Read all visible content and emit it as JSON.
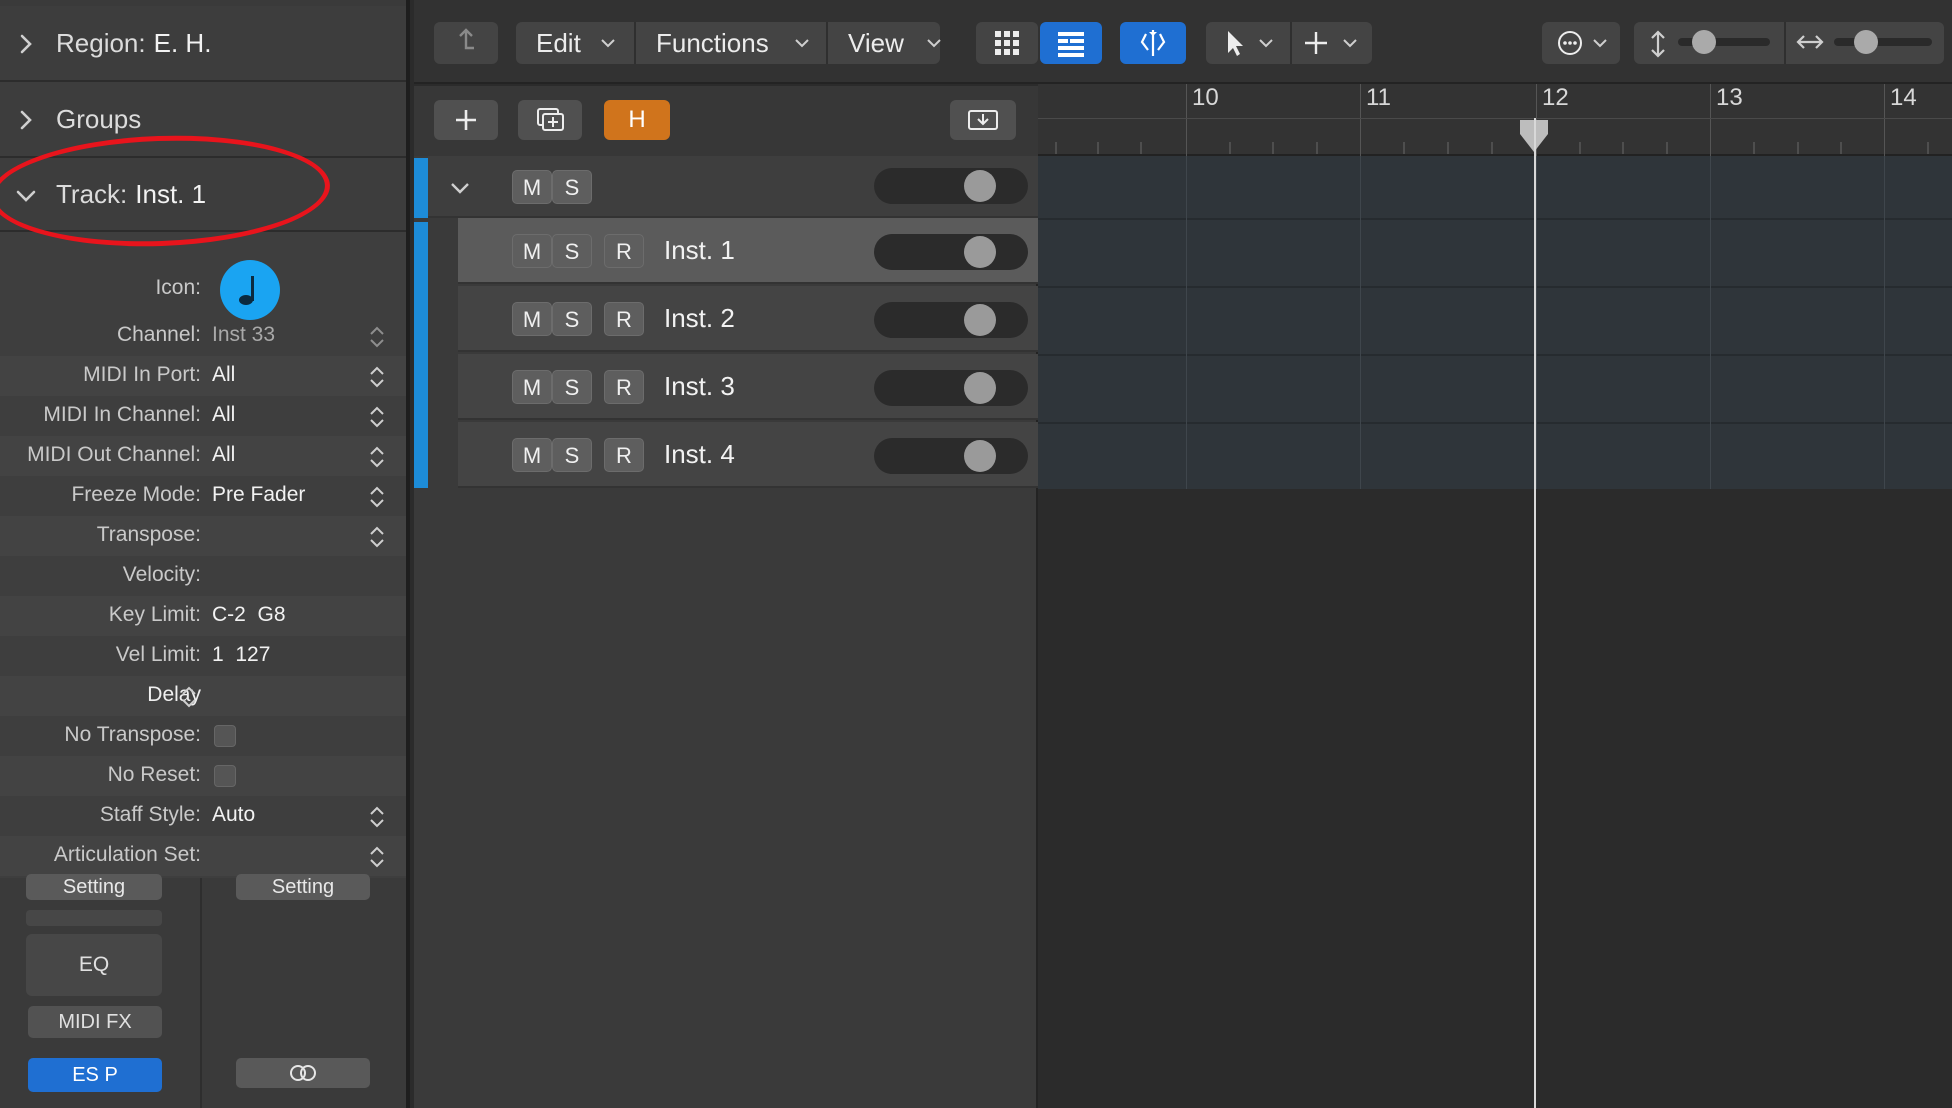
{
  "inspector": {
    "region": {
      "label": "Region:",
      "value": "E. H."
    },
    "groups": {
      "label": "Groups"
    },
    "track": {
      "label": "Track:",
      "value": "Inst. 1"
    },
    "icon_label": "Icon:",
    "icon_color": "#1aa4f2",
    "props": [
      {
        "label": "Channel:",
        "value": "Inst 33"
      },
      {
        "label": "MIDI In Port:",
        "value": "All"
      },
      {
        "label": "MIDI In Channel:",
        "value": "All"
      },
      {
        "label": "MIDI Out Channel:",
        "value": "All"
      },
      {
        "label": "Freeze Mode:",
        "value": "Pre Fader"
      },
      {
        "label": "Transpose:",
        "value": ""
      },
      {
        "label": "Velocity:",
        "value": ""
      },
      {
        "label": "Key Limit:",
        "value": "C-2  G8"
      },
      {
        "label": "Vel Limit:",
        "value": "1  127"
      },
      {
        "label": "Delay",
        "value": ""
      },
      {
        "label": "No Transpose:",
        "value": ""
      },
      {
        "label": "No Reset:",
        "value": ""
      },
      {
        "label": "Staff Style:",
        "value": "Auto"
      },
      {
        "label": "Articulation Set:",
        "value": ""
      }
    ],
    "strip": {
      "setting_left": "Setting",
      "setting_right": "Setting",
      "eq": "EQ",
      "midi_fx": "MIDI FX",
      "instrument": "ES P"
    }
  },
  "toolbar": {
    "edit": "Edit",
    "functions": "Functions",
    "view": "View"
  },
  "track_header": {
    "hide_button": "H",
    "folder_row": {
      "mute": "M",
      "solo": "S"
    },
    "tracks": [
      {
        "mute": "M",
        "solo": "S",
        "record": "R",
        "name": "Inst. 1"
      },
      {
        "mute": "M",
        "solo": "S",
        "record": "R",
        "name": "Inst. 2"
      },
      {
        "mute": "M",
        "solo": "S",
        "record": "R",
        "name": "Inst. 3"
      },
      {
        "mute": "M",
        "solo": "S",
        "record": "R",
        "name": "Inst. 4"
      }
    ]
  },
  "ruler": {
    "bars": [
      "10",
      "11",
      "12",
      "13",
      "14"
    ]
  },
  "colors": {
    "accent_blue": "#1f6fd2",
    "track_color": "#1d8cd8",
    "hide_orange": "#d0741c",
    "annotation_red": "#e8141c"
  }
}
